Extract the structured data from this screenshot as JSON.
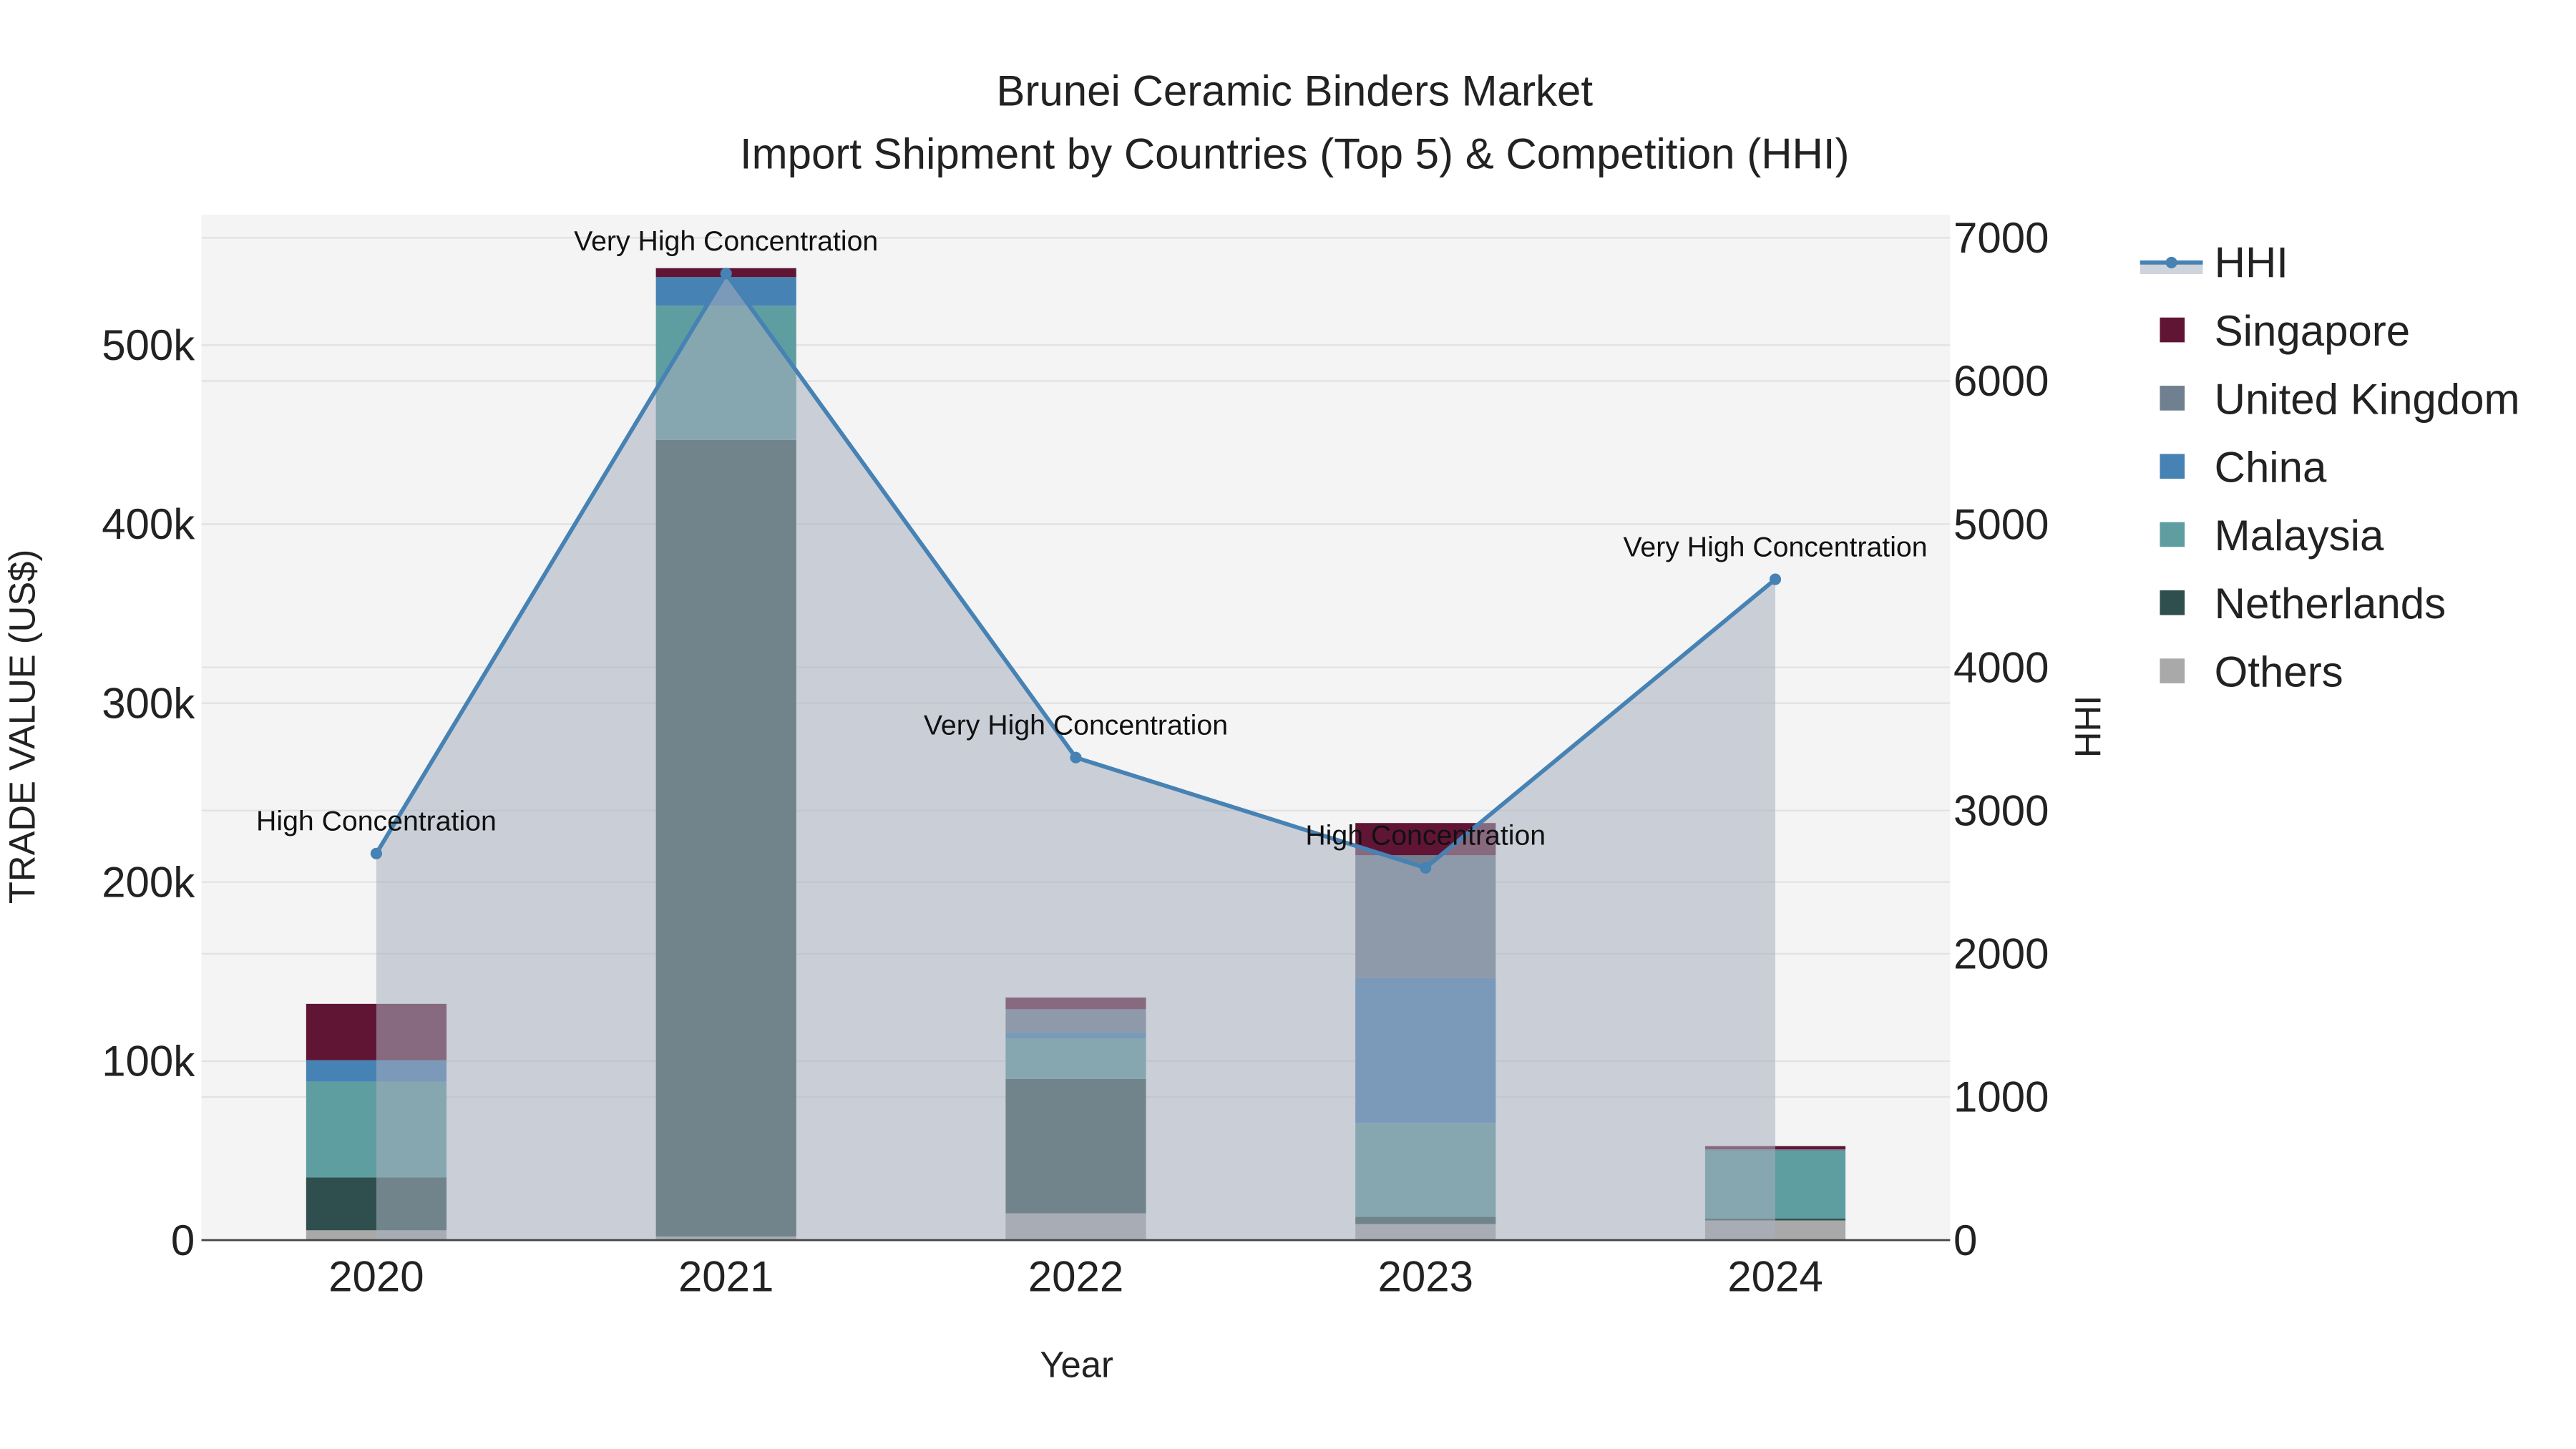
{
  "chart_data": {
    "type": "bar",
    "title": "Brunei Ceramic Binders Market",
    "subtitle": "Import Shipment by Countries (Top 5) & Competition (HHI)",
    "xlabel": "Year",
    "ylabel": "TRADE VALUE (US$)",
    "y2label": "HHI",
    "categories": [
      "2020",
      "2021",
      "2022",
      "2023",
      "2024"
    ],
    "ylim": [
      0,
      570000
    ],
    "y2lim": [
      0,
      7150
    ],
    "yticks": [
      0,
      100000,
      200000,
      300000,
      400000,
      500000
    ],
    "ytick_labels": [
      "0",
      "100k",
      "200k",
      "300k",
      "400k",
      "500k"
    ],
    "y2ticks": [
      0,
      1000,
      2000,
      3000,
      4000,
      5000,
      6000,
      7000
    ],
    "y2tick_labels": [
      "0",
      "1000",
      "2000",
      "3000",
      "4000",
      "5000",
      "6000",
      "7000"
    ],
    "stacked": true,
    "series": [
      {
        "name": "Others",
        "color": "#A9A9A9",
        "values": [
          5500,
          2000,
          15000,
          9000,
          11000
        ]
      },
      {
        "name": "Netherlands",
        "color": "#2F4F4F",
        "values": [
          29500,
          445000,
          75000,
          4000,
          1000
        ]
      },
      {
        "name": "Malaysia",
        "color": "#5F9EA0",
        "values": [
          53500,
          75000,
          22500,
          52500,
          38000
        ]
      },
      {
        "name": "China",
        "color": "#4682B4",
        "values": [
          12000,
          16000,
          3500,
          81000,
          0
        ]
      },
      {
        "name": "United Kingdom",
        "color": "#708090",
        "values": [
          0,
          0,
          13000,
          68500,
          700
        ]
      },
      {
        "name": "Singapore",
        "color": "#611535",
        "values": [
          31500,
          5000,
          6500,
          18000,
          1800
        ]
      }
    ],
    "line": {
      "name": "HHI",
      "color": "#4682B4",
      "values": [
        2700,
        6750,
        3370,
        2600,
        4615
      ],
      "annotations": [
        "High Concentration",
        "Very High Concentration",
        "Very High Concentration",
        "High Concentration",
        "Very High Concentration"
      ]
    },
    "legend": [
      "HHI",
      "Singapore",
      "United Kingdom",
      "China",
      "Malaysia",
      "Netherlands",
      "Others"
    ],
    "legend_position": "right",
    "grid": true
  }
}
